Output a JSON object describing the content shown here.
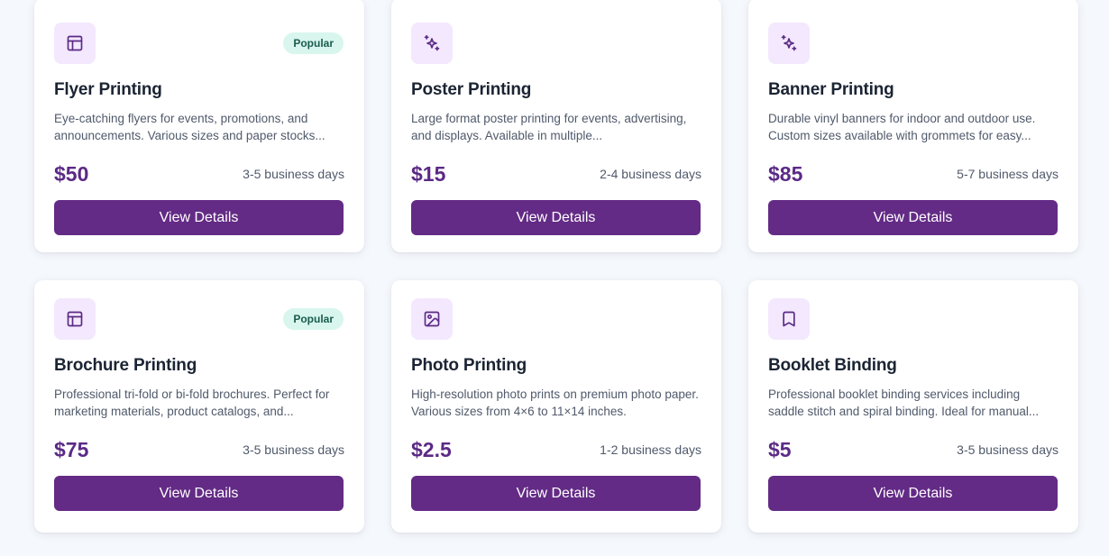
{
  "colors": {
    "accent": "#632b85",
    "price": "#5b2a86",
    "icon_bg": "#f3e8fd",
    "badge_bg": "#d8f6ee",
    "badge_text": "#185c4d",
    "background": "#f5f8fc"
  },
  "services": [
    {
      "icon": "layout-icon",
      "badge": "Popular",
      "title": "Flyer Printing",
      "description": "Eye-catching flyers for events, promotions, and announcements. Various sizes and paper stocks...",
      "price": "$50",
      "turnaround": "3-5 business days",
      "button_label": "View Details"
    },
    {
      "icon": "sparkles-icon",
      "badge": "",
      "title": "Poster Printing",
      "description": "Large format poster printing for events, advertising, and displays. Available in multiple...",
      "price": "$15",
      "turnaround": "2-4 business days",
      "button_label": "View Details"
    },
    {
      "icon": "sparkles-icon",
      "badge": "",
      "title": "Banner Printing",
      "description": "Durable vinyl banners for indoor and outdoor use. Custom sizes available with grommets for easy...",
      "price": "$85",
      "turnaround": "5-7 business days",
      "button_label": "View Details"
    },
    {
      "icon": "layout-icon",
      "badge": "Popular",
      "title": "Brochure Printing",
      "description": "Professional tri-fold or bi-fold brochures. Perfect for marketing materials, product catalogs, and...",
      "price": "$75",
      "turnaround": "3-5 business days",
      "button_label": "View Details"
    },
    {
      "icon": "image-icon",
      "badge": "",
      "title": "Photo Printing",
      "description": "High-resolution photo prints on premium photo paper. Various sizes from 4×6 to 11×14 inches.",
      "price": "$2.5",
      "turnaround": "1-2 business days",
      "button_label": "View Details"
    },
    {
      "icon": "bookmark-icon",
      "badge": "",
      "title": "Booklet Binding",
      "description": "Professional booklet binding services including saddle stitch and spiral binding. Ideal for manual...",
      "price": "$5",
      "turnaround": "3-5 business days",
      "button_label": "View Details"
    }
  ]
}
